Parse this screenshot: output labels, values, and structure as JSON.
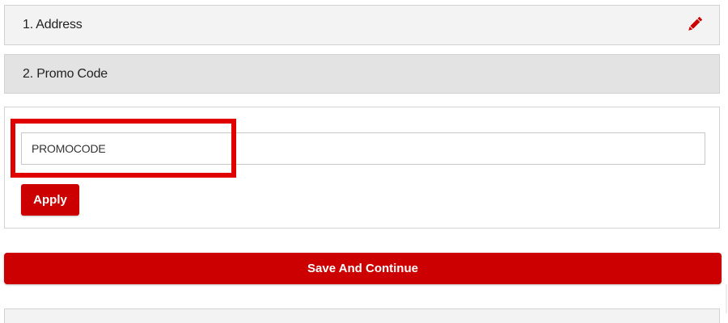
{
  "steps": {
    "address": {
      "title": "1. Address",
      "edit_icon": "pencil-icon"
    },
    "promo": {
      "title": "2. Promo Code"
    }
  },
  "promo_form": {
    "input_value": "PROMOCODE",
    "apply_label": "Apply"
  },
  "actions": {
    "save_label": "Save And Continue"
  },
  "colors": {
    "accent": "#cc0000",
    "highlight": "#e00000",
    "header_bg": "#f3f3f3",
    "active_header_bg": "#e3e3e3",
    "border": "#d2d2d2"
  }
}
